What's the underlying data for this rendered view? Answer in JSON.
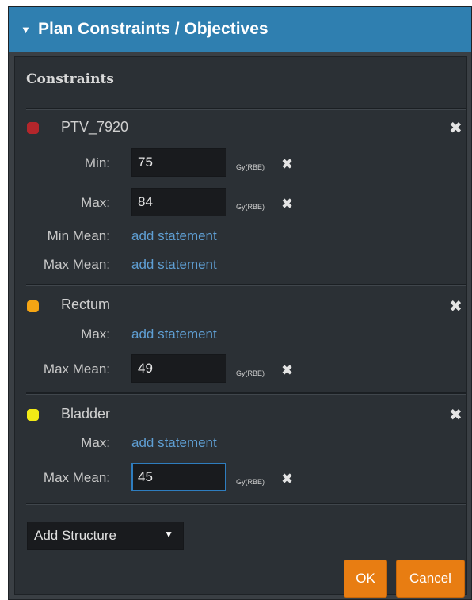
{
  "header": {
    "title": "Plan Constraints / Objectives",
    "caret_icon": "triangle-down-icon"
  },
  "constraints": {
    "section_title": "Constraints",
    "remove_glyph": "✖",
    "unit_label": "Gy(RBE)",
    "link_label": "add statement",
    "structures": [
      {
        "name": "PTV_7920",
        "color": "#b3262b",
        "min_label": "Min:",
        "min_value": "75",
        "max_label": "Max:",
        "max_value": "84",
        "min_mean_label": "Min Mean:",
        "max_mean_label": "Max Mean:"
      },
      {
        "name": "Rectum",
        "color": "#f5a514",
        "max_label": "Max:",
        "max_mean_label": "Max Mean:",
        "max_mean_value": "49"
      },
      {
        "name": "Bladder",
        "color": "#f2ea16",
        "max_label": "Max:",
        "max_mean_label": "Max Mean:",
        "max_mean_value": "45"
      }
    ]
  },
  "add_structure": {
    "label": "Add Structure",
    "arrow": "▼"
  },
  "footer": {
    "ok_label": "OK",
    "cancel_label": "Cancel"
  },
  "colors": {
    "header_bg": "#2f7fb0",
    "panel_bg": "#2b3035",
    "button_bg": "#e87d12",
    "link": "#5f9fd4"
  }
}
